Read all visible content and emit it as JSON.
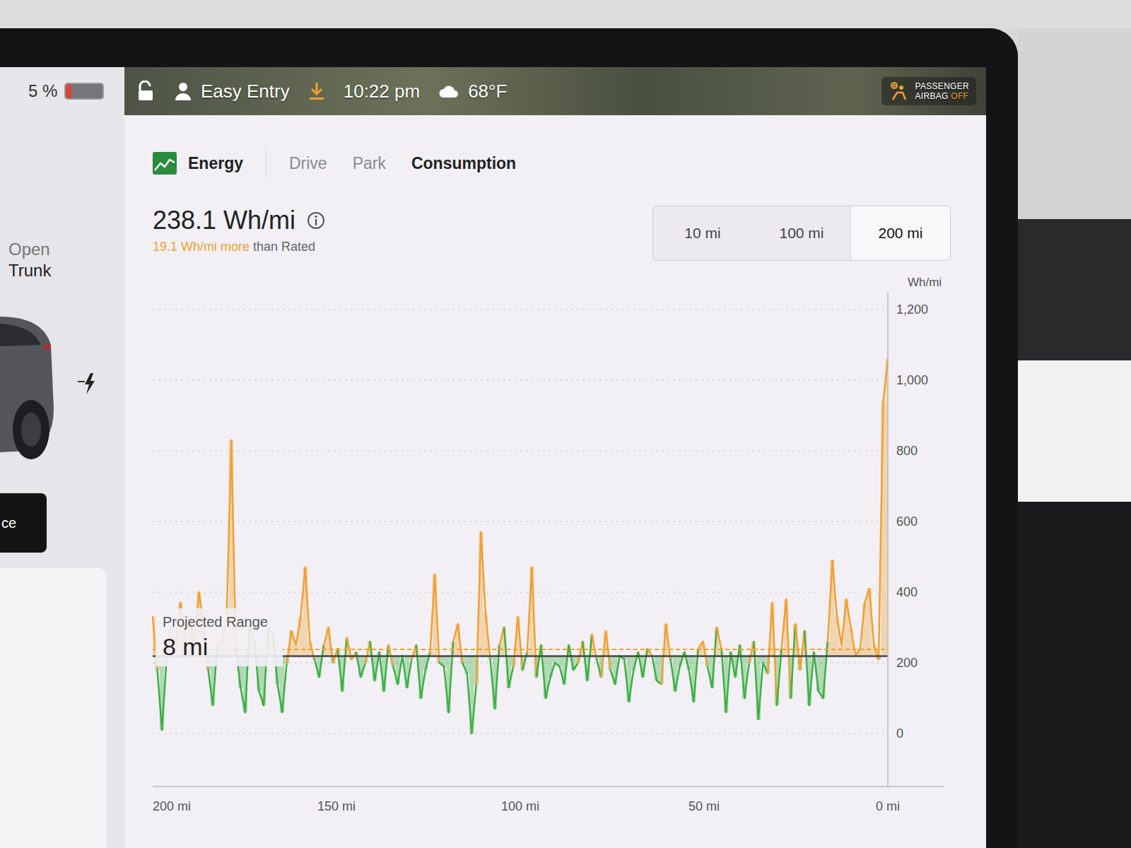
{
  "status_bar": {
    "battery": {
      "text": "5 %",
      "level": 0.05,
      "color": "#d9453a"
    },
    "profile": "Easy Entry",
    "time": "10:22 pm",
    "temperature": "68°F",
    "airbag": {
      "line1": "PASSENGER",
      "line2": "AIRBAG",
      "state": "OFF"
    }
  },
  "car_panel": {
    "trunk_action": [
      "Open",
      "Trunk"
    ],
    "charging": true,
    "button": "ce"
  },
  "energy": {
    "title": "Energy",
    "tabs": [
      {
        "label": "Drive",
        "selected": false
      },
      {
        "label": "Park",
        "selected": false
      },
      {
        "label": "Consumption",
        "selected": true
      }
    ],
    "average": "238.1 Wh/mi",
    "delta": "19.1 Wh/mi more",
    "delta_suffix": "than Rated",
    "ranges": [
      {
        "label": "10 mi",
        "selected": false
      },
      {
        "label": "100 mi",
        "selected": false
      },
      {
        "label": "200 mi",
        "selected": true
      }
    ],
    "chart": {
      "unit": "Wh/mi",
      "y_ticks": [
        "1,200",
        "1,000",
        "800",
        "600",
        "400",
        "200",
        "0"
      ],
      "x_ticks": [
        "200 mi",
        "150 mi",
        "100 mi",
        "50 mi",
        "0 mi"
      ],
      "rated": 219,
      "average": 238.1,
      "values": [
        330,
        180,
        10,
        210,
        300,
        250,
        370,
        280,
        330,
        240,
        400,
        310,
        180,
        80,
        250,
        260,
        330,
        830,
        240,
        130,
        60,
        310,
        260,
        120,
        80,
        300,
        280,
        140,
        60,
        200,
        290,
        250,
        330,
        470,
        260,
        210,
        160,
        250,
        300,
        200,
        240,
        120,
        270,
        210,
        230,
        160,
        200,
        260,
        150,
        230,
        120,
        250,
        190,
        140,
        220,
        130,
        210,
        250,
        100,
        180,
        230,
        450,
        200,
        190,
        60,
        260,
        310,
        200,
        170,
        0,
        140,
        570,
        340,
        210,
        70,
        250,
        300,
        130,
        190,
        330,
        180,
        230,
        470,
        160,
        250,
        100,
        160,
        200,
        190,
        140,
        250,
        180,
        200,
        260,
        150,
        280,
        210,
        160,
        290,
        180,
        140,
        220,
        210,
        90,
        180,
        230,
        160,
        240,
        220,
        150,
        140,
        310,
        210,
        120,
        190,
        230,
        180,
        90,
        240,
        260,
        190,
        130,
        300,
        240,
        60,
        230,
        160,
        250,
        100,
        200,
        260,
        40,
        200,
        170,
        370,
        80,
        240,
        380,
        100,
        310,
        180,
        290,
        80,
        230,
        120,
        100,
        260,
        490,
        330,
        250,
        380,
        300,
        220,
        240,
        370,
        410,
        250,
        210,
        940,
        1060
      ]
    },
    "projected_range": {
      "label": "Projected Range",
      "value": "8 mi"
    }
  }
}
